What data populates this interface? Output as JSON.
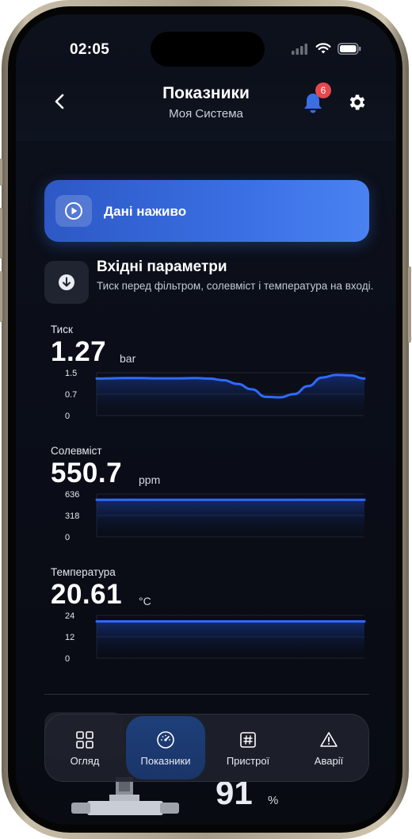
{
  "status_bar": {
    "time": "02:05"
  },
  "header": {
    "title": "Показники",
    "subtitle": "Моя Система",
    "notification_count": "6"
  },
  "live_button": {
    "label": "Дані наживо"
  },
  "section": {
    "title": "Вхідні параметри",
    "description": "Тиск перед фільтром, солевміст і температура на вході."
  },
  "metrics": [
    {
      "label": "Тиск",
      "value": "1.27",
      "unit": "bar",
      "ticks": [
        "1.5",
        "0.7",
        "0"
      ],
      "series": [
        1.38,
        1.39,
        1.4,
        1.4,
        1.39,
        1.39,
        1.39,
        1.4,
        1.38,
        1.32,
        1.18,
        0.98,
        0.7,
        0.68,
        0.8,
        1.1,
        1.42,
        1.52,
        1.5,
        1.38
      ],
      "ymax": 1.6
    },
    {
      "label": "Солевміст",
      "value": "550.7",
      "unit": "ppm",
      "ticks": [
        "636",
        "318",
        "0"
      ],
      "series": [
        550,
        550,
        550,
        550,
        550,
        550,
        550,
        550,
        550,
        550,
        550
      ],
      "ymax": 636
    },
    {
      "label": "Температура",
      "value": "20.61",
      "unit": "°C",
      "ticks": [
        "24",
        "12",
        "0"
      ],
      "series": [
        20.6,
        20.6,
        20.6,
        20.6,
        20.6,
        20.6,
        20.6,
        20.6,
        20.6,
        20.6,
        20.6
      ],
      "ymax": 24
    }
  ],
  "bottom_peek": {
    "value": "91",
    "unit": "%"
  },
  "tabbar": {
    "tabs": [
      {
        "label": "Огляд",
        "icon": "grid-icon"
      },
      {
        "label": "Показники",
        "icon": "gauge-icon"
      },
      {
        "label": "Пристрої",
        "icon": "hash-icon"
      },
      {
        "label": "Аварії",
        "icon": "warning-icon"
      }
    ]
  },
  "colors": {
    "accent": "#3a6fe3",
    "line": "#2f6bff",
    "badge": "#e5484d"
  }
}
